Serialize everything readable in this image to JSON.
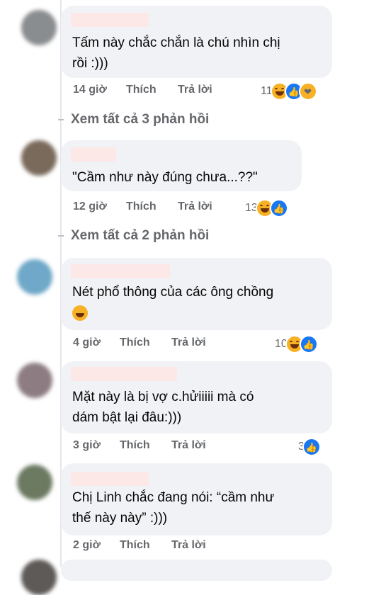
{
  "comments": [
    {
      "text_lines": [
        "Tấm này chắc chắn là chú nhìn chị",
        "rồi :)))"
      ],
      "time": "14 giờ",
      "like_label": "Thích",
      "reply_label": "Trả lời",
      "reaction_count": "11",
      "reactions": [
        "haha-icon",
        "like-icon",
        "care-icon"
      ]
    },
    {
      "text_lines": [
        "\"Cầm như này đúng chưa...??\""
      ],
      "time": "12 giờ",
      "like_label": "Thích",
      "reply_label": "Trả lời",
      "reaction_count": "13",
      "reactions": [
        "haha-icon",
        "like-icon"
      ]
    },
    {
      "text_lines": [
        "Nét phổ thông của các ông chồng"
      ],
      "time": "4 giờ",
      "like_label": "Thích",
      "reply_label": "Trả lời",
      "reaction_count": "10",
      "reactions": [
        "haha-icon",
        "like-icon"
      ]
    },
    {
      "text_lines": [
        "Mặt này là bị vợ c.hửiiiii mà có",
        "dám bật lại đâu:)))"
      ],
      "time": "3 giờ",
      "like_label": "Thích",
      "reply_label": "Trả lời",
      "reaction_count": "3",
      "reactions": [
        "like-icon"
      ]
    },
    {
      "text_lines": [
        "Chị Linh chắc đang nói: “cầm như",
        "thế này này” :)))"
      ],
      "time": "2 giờ",
      "like_label": "Thích",
      "reply_label": "Trả lời",
      "reaction_count": "",
      "reactions": []
    }
  ],
  "view_replies": [
    "Xem tất cả 3 phản hồi",
    "Xem tất cả 2 phản hồi"
  ],
  "colors": {
    "bubble": "#f0f2f5",
    "meta_text": "#65676b",
    "like_blue": "#1877f2",
    "haha_yellow": "#f7b125"
  }
}
